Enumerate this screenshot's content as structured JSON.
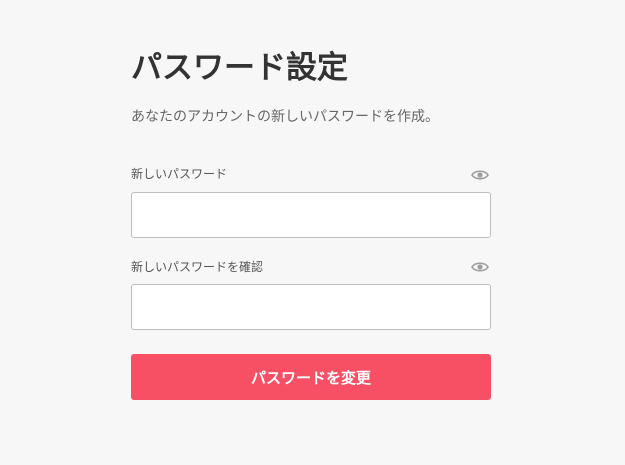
{
  "title": "パスワード設定",
  "subtitle": "あなたのアカウントの新しいパスワードを作成。",
  "fields": {
    "new_password": {
      "label": "新しいパスワード",
      "value": "",
      "toggle_icon": "eye-icon"
    },
    "confirm_password": {
      "label": "新しいパスワードを確認",
      "value": "",
      "toggle_icon": "eye-icon"
    }
  },
  "submit_label": "パスワードを変更",
  "colors": {
    "background": "#f7f7f7",
    "accent": "#f74f63",
    "title": "#333333",
    "muted": "#666666",
    "icon": "#9e9e9e",
    "input_border": "#bdbdbd"
  }
}
